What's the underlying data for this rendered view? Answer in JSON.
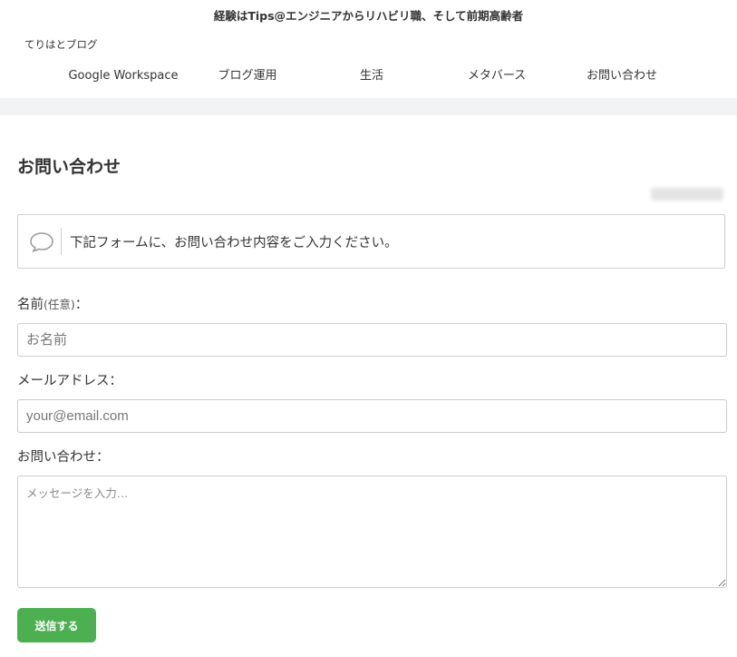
{
  "header": {
    "tagline": "経験はTips@エンジニアからリハビリ職、そして前期高齢者",
    "logo": "てりはとブログ",
    "nav": [
      {
        "label": "Google Workspace"
      },
      {
        "label": "ブログ運用"
      },
      {
        "label": "生活"
      },
      {
        "label": "メタバース"
      },
      {
        "label": "お問い合わせ"
      }
    ]
  },
  "main": {
    "title": "お問い合わせ",
    "notice": {
      "icon": "speech-bubble-icon",
      "text": "下記フォームに、お問い合わせ内容をご入力ください。"
    },
    "form": {
      "name_label": "名前",
      "name_optional": "(任意)",
      "name_label_suffix": "：",
      "name_placeholder": "お名前",
      "email_label": "メールアドレス：",
      "email_placeholder": "your@email.com",
      "message_label": "お問い合わせ：",
      "message_placeholder": "メッセージを入力…",
      "submit_label": "送信する"
    }
  },
  "colors": {
    "submit_button": "#4caf50",
    "band": "#f2f3f5",
    "border": "#cccccc"
  }
}
